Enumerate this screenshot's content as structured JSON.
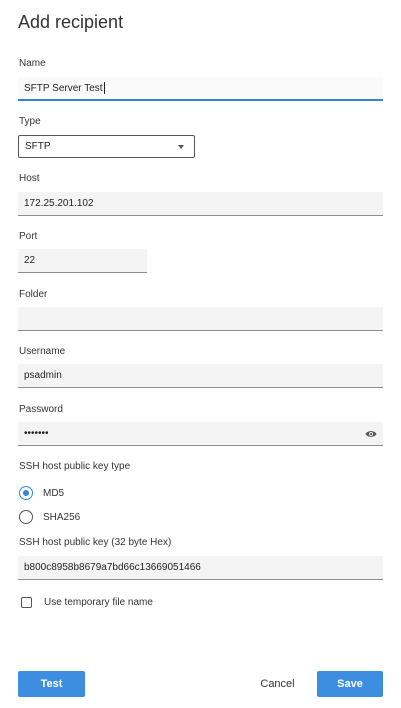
{
  "dialog": {
    "title": "Add recipient"
  },
  "name": {
    "label": "Name",
    "value": "SFTP Server Test"
  },
  "type": {
    "label": "Type",
    "selected": "SFTP"
  },
  "host": {
    "label": "Host",
    "value": "172.25.201.102"
  },
  "port": {
    "label": "Port",
    "value": "22"
  },
  "folder": {
    "label": "Folder",
    "value": ""
  },
  "username": {
    "label": "Username",
    "value": "psadmin"
  },
  "password": {
    "label": "Password",
    "value": "•••••••",
    "toggle_icon": "eye-icon"
  },
  "ssh_key_type": {
    "label": "SSH host public key type",
    "options": [
      {
        "label": "MD5",
        "checked": true
      },
      {
        "label": "SHA256",
        "checked": false
      }
    ]
  },
  "ssh_key": {
    "label": "SSH host public key (32 byte Hex)",
    "value": "b800c8958b8679a7bd66c13669051466"
  },
  "temp_file": {
    "label": "Use temporary file name",
    "checked": false
  },
  "buttons": {
    "test": "Test",
    "cancel": "Cancel",
    "save": "Save"
  },
  "colors": {
    "accent": "#3d8ee0",
    "field_bg": "#f4f4f4"
  }
}
